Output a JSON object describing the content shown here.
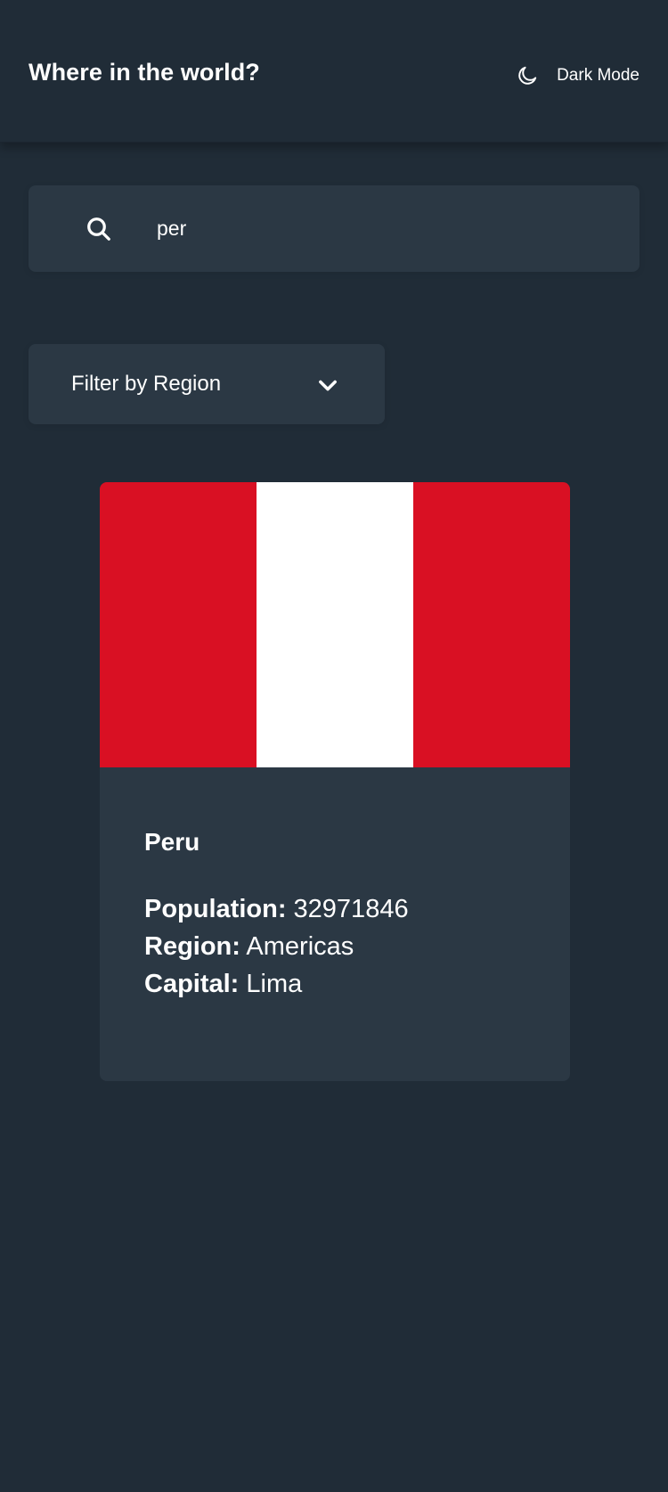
{
  "header": {
    "title": "Where in the world?",
    "theme_toggle": {
      "label": "Dark Mode",
      "icon": "moon-icon"
    }
  },
  "search": {
    "value": "per",
    "icon": "search-icon"
  },
  "filter": {
    "label": "Filter by Region",
    "icon": "chevron-down-icon"
  },
  "countries": [
    {
      "name": "Peru",
      "flag_colors": [
        "#d91023",
        "#ffffff",
        "#d91023"
      ],
      "population_label": "Population:",
      "population": "32971846",
      "region_label": "Region:",
      "region": "Americas",
      "capital_label": "Capital:",
      "capital": "Lima"
    }
  ],
  "colors": {
    "background": "#202c37",
    "elements": "#2b3844",
    "text": "#ffffff"
  }
}
